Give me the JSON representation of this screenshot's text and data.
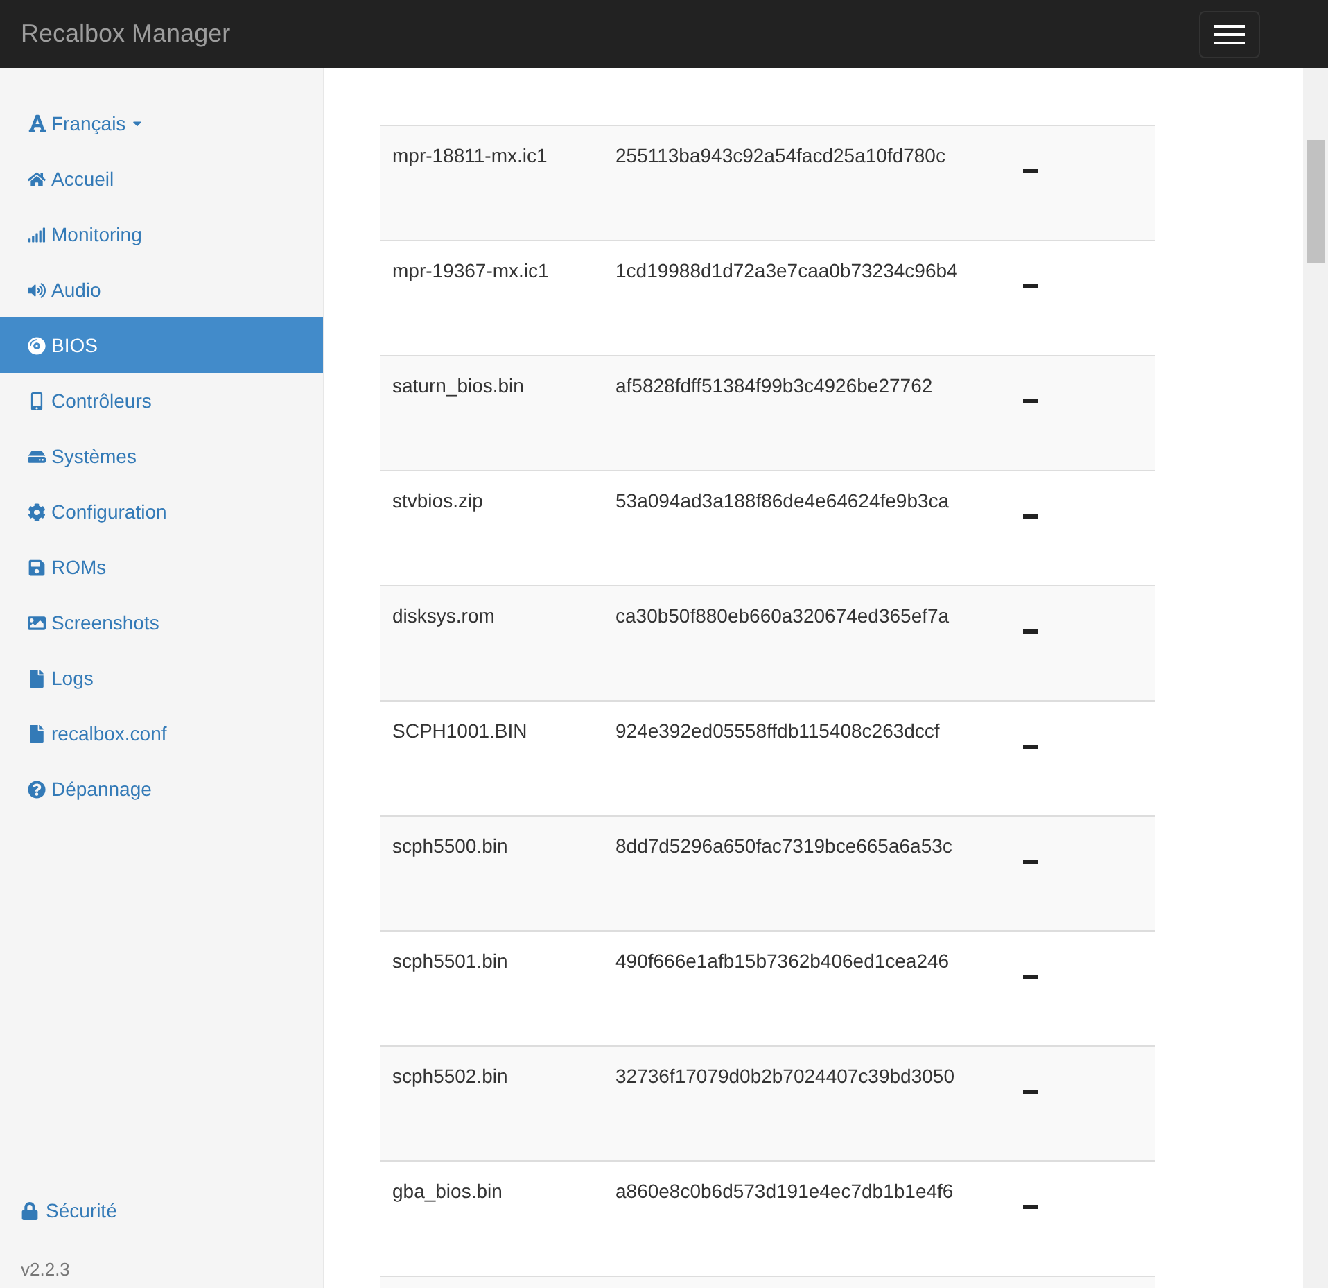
{
  "navbar": {
    "brand": "Recalbox Manager"
  },
  "sidebar": {
    "language": "Français",
    "items": [
      {
        "label": "Accueil",
        "selected": false
      },
      {
        "label": "Monitoring",
        "selected": false
      },
      {
        "label": "Audio",
        "selected": false
      },
      {
        "label": "BIOS",
        "selected": true
      },
      {
        "label": "Contrôleurs",
        "selected": false
      },
      {
        "label": "Systèmes",
        "selected": false
      },
      {
        "label": "Configuration",
        "selected": false
      },
      {
        "label": "ROMs",
        "selected": false
      },
      {
        "label": "Screenshots",
        "selected": false
      },
      {
        "label": "Logs",
        "selected": false
      },
      {
        "label": "recalbox.conf",
        "selected": false
      },
      {
        "label": "Dépannage",
        "selected": false
      }
    ],
    "security": "Sécurité",
    "version": "v2.2.3"
  },
  "table": {
    "rows": [
      {
        "file": "mpr-18811-mx.ic1",
        "md5": "255113ba943c92a54facd25a10fd780c"
      },
      {
        "file": "mpr-19367-mx.ic1",
        "md5": "1cd19988d1d72a3e7caa0b73234c96b4"
      },
      {
        "file": "saturn_bios.bin",
        "md5": "af5828fdff51384f99b3c4926be27762"
      },
      {
        "file": "stvbios.zip",
        "md5": "53a094ad3a188f86de4e64624fe9b3ca"
      },
      {
        "file": "disksys.rom",
        "md5": "ca30b50f880eb660a320674ed365ef7a"
      },
      {
        "file": "SCPH1001.BIN",
        "md5": "924e392ed05558ffdb115408c263dccf"
      },
      {
        "file": "scph5500.bin",
        "md5": "8dd7d5296a650fac7319bce665a6a53c"
      },
      {
        "file": "scph5501.bin",
        "md5": "490f666e1afb15b7362b406ed1cea246"
      },
      {
        "file": "scph5502.bin",
        "md5": "32736f17079d0b2b7024407c39bd3050"
      },
      {
        "file": "gba_bios.bin",
        "md5": "a860e8c0b6d573d191e4ec7db1b1e4f6"
      }
    ]
  }
}
